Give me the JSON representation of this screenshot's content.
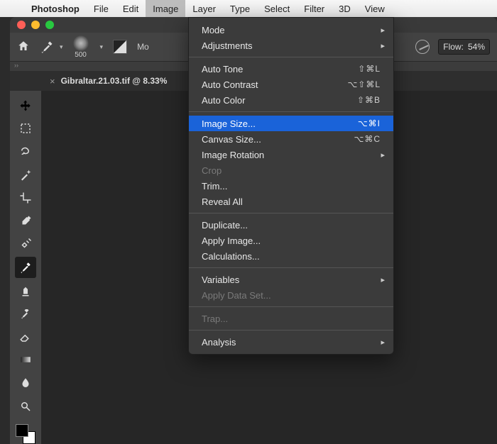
{
  "menubar": {
    "app": "Photoshop",
    "items": [
      "File",
      "Edit",
      "Image",
      "Layer",
      "Type",
      "Select",
      "Filter",
      "3D",
      "View"
    ],
    "active_index": 2
  },
  "optionsbar": {
    "brush_size": "500",
    "mode_label_trunc": "Mo",
    "flow_label": "Flow:",
    "flow_value": "54%"
  },
  "tab": {
    "close_glyph": "×",
    "title": "Gibraltar.21.03.tif @ 8.33%"
  },
  "tools": [
    {
      "name": "move-tool"
    },
    {
      "name": "marquee-tool"
    },
    {
      "name": "lasso-tool"
    },
    {
      "name": "magic-wand-tool"
    },
    {
      "name": "crop-tool"
    },
    {
      "name": "eyedropper-tool"
    },
    {
      "name": "healing-brush-tool"
    },
    {
      "name": "brush-tool",
      "selected": true
    },
    {
      "name": "clone-stamp-tool"
    },
    {
      "name": "history-brush-tool"
    },
    {
      "name": "eraser-tool"
    },
    {
      "name": "gradient-tool"
    },
    {
      "name": "blur-tool"
    },
    {
      "name": "dodge-tool"
    }
  ],
  "image_menu": {
    "groups": [
      [
        {
          "label": "Mode",
          "submenu": true
        },
        {
          "label": "Adjustments",
          "submenu": true
        }
      ],
      [
        {
          "label": "Auto Tone",
          "shortcut": "⇧⌘L"
        },
        {
          "label": "Auto Contrast",
          "shortcut": "⌥⇧⌘L"
        },
        {
          "label": "Auto Color",
          "shortcut": "⇧⌘B"
        }
      ],
      [
        {
          "label": "Image Size...",
          "shortcut": "⌥⌘I",
          "highlight": true
        },
        {
          "label": "Canvas Size...",
          "shortcut": "⌥⌘C"
        },
        {
          "label": "Image Rotation",
          "submenu": true
        },
        {
          "label": "Crop",
          "disabled": true
        },
        {
          "label": "Trim..."
        },
        {
          "label": "Reveal All"
        }
      ],
      [
        {
          "label": "Duplicate..."
        },
        {
          "label": "Apply Image..."
        },
        {
          "label": "Calculations..."
        }
      ],
      [
        {
          "label": "Variables",
          "submenu": true
        },
        {
          "label": "Apply Data Set...",
          "disabled": true
        }
      ],
      [
        {
          "label": "Trap...",
          "disabled": true
        }
      ],
      [
        {
          "label": "Analysis",
          "submenu": true
        }
      ]
    ]
  }
}
